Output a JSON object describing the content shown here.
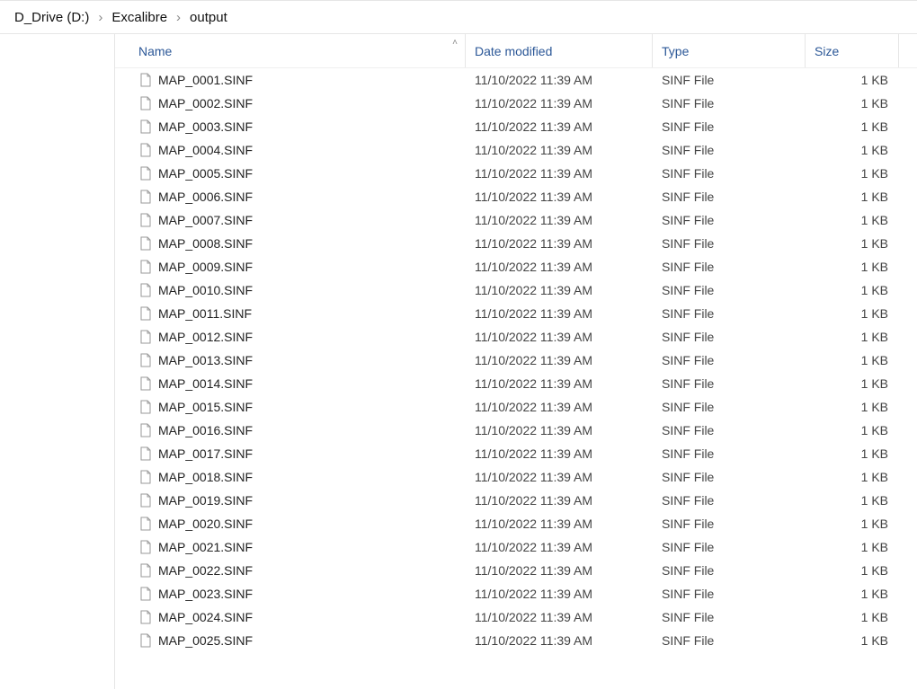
{
  "breadcrumb": {
    "items": [
      "D_Drive (D:)",
      "Excalibre",
      "output"
    ]
  },
  "columns": {
    "name": "Name",
    "date": "Date modified",
    "type": "Type",
    "size": "Size",
    "sorted_column": "name",
    "sort_direction": "asc"
  },
  "files": [
    {
      "name": "MAP_0001.SINF",
      "date": "11/10/2022 11:39 AM",
      "type": "SINF File",
      "size": "1 KB"
    },
    {
      "name": "MAP_0002.SINF",
      "date": "11/10/2022 11:39 AM",
      "type": "SINF File",
      "size": "1 KB"
    },
    {
      "name": "MAP_0003.SINF",
      "date": "11/10/2022 11:39 AM",
      "type": "SINF File",
      "size": "1 KB"
    },
    {
      "name": "MAP_0004.SINF",
      "date": "11/10/2022 11:39 AM",
      "type": "SINF File",
      "size": "1 KB"
    },
    {
      "name": "MAP_0005.SINF",
      "date": "11/10/2022 11:39 AM",
      "type": "SINF File",
      "size": "1 KB"
    },
    {
      "name": "MAP_0006.SINF",
      "date": "11/10/2022 11:39 AM",
      "type": "SINF File",
      "size": "1 KB"
    },
    {
      "name": "MAP_0007.SINF",
      "date": "11/10/2022 11:39 AM",
      "type": "SINF File",
      "size": "1 KB"
    },
    {
      "name": "MAP_0008.SINF",
      "date": "11/10/2022 11:39 AM",
      "type": "SINF File",
      "size": "1 KB"
    },
    {
      "name": "MAP_0009.SINF",
      "date": "11/10/2022 11:39 AM",
      "type": "SINF File",
      "size": "1 KB"
    },
    {
      "name": "MAP_0010.SINF",
      "date": "11/10/2022 11:39 AM",
      "type": "SINF File",
      "size": "1 KB"
    },
    {
      "name": "MAP_0011.SINF",
      "date": "11/10/2022 11:39 AM",
      "type": "SINF File",
      "size": "1 KB"
    },
    {
      "name": "MAP_0012.SINF",
      "date": "11/10/2022 11:39 AM",
      "type": "SINF File",
      "size": "1 KB"
    },
    {
      "name": "MAP_0013.SINF",
      "date": "11/10/2022 11:39 AM",
      "type": "SINF File",
      "size": "1 KB"
    },
    {
      "name": "MAP_0014.SINF",
      "date": "11/10/2022 11:39 AM",
      "type": "SINF File",
      "size": "1 KB"
    },
    {
      "name": "MAP_0015.SINF",
      "date": "11/10/2022 11:39 AM",
      "type": "SINF File",
      "size": "1 KB"
    },
    {
      "name": "MAP_0016.SINF",
      "date": "11/10/2022 11:39 AM",
      "type": "SINF File",
      "size": "1 KB"
    },
    {
      "name": "MAP_0017.SINF",
      "date": "11/10/2022 11:39 AM",
      "type": "SINF File",
      "size": "1 KB"
    },
    {
      "name": "MAP_0018.SINF",
      "date": "11/10/2022 11:39 AM",
      "type": "SINF File",
      "size": "1 KB"
    },
    {
      "name": "MAP_0019.SINF",
      "date": "11/10/2022 11:39 AM",
      "type": "SINF File",
      "size": "1 KB"
    },
    {
      "name": "MAP_0020.SINF",
      "date": "11/10/2022 11:39 AM",
      "type": "SINF File",
      "size": "1 KB"
    },
    {
      "name": "MAP_0021.SINF",
      "date": "11/10/2022 11:39 AM",
      "type": "SINF File",
      "size": "1 KB"
    },
    {
      "name": "MAP_0022.SINF",
      "date": "11/10/2022 11:39 AM",
      "type": "SINF File",
      "size": "1 KB"
    },
    {
      "name": "MAP_0023.SINF",
      "date": "11/10/2022 11:39 AM",
      "type": "SINF File",
      "size": "1 KB"
    },
    {
      "name": "MAP_0024.SINF",
      "date": "11/10/2022 11:39 AM",
      "type": "SINF File",
      "size": "1 KB"
    },
    {
      "name": "MAP_0025.SINF",
      "date": "11/10/2022 11:39 AM",
      "type": "SINF File",
      "size": "1 KB"
    }
  ]
}
